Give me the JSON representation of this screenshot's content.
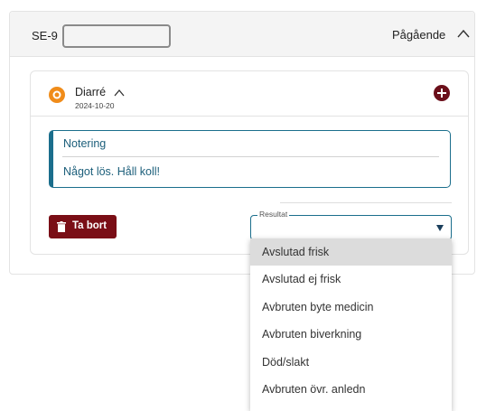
{
  "case": {
    "id_prefix": "SE-9",
    "status": "Pågående"
  },
  "diagnosis": {
    "title": "Diarré",
    "date": "2024-10-20"
  },
  "note": {
    "title": "Notering",
    "text": "Något lös. Håll koll!"
  },
  "actions": {
    "delete_label": "Ta bort"
  },
  "result": {
    "legend": "Resultat",
    "value": "",
    "options": [
      {
        "label": "Avslutad frisk",
        "highlighted": true
      },
      {
        "label": "Avslutad ej frisk",
        "highlighted": false
      },
      {
        "label": "Avbruten byte medicin",
        "highlighted": false
      },
      {
        "label": "Avbruten biverkning",
        "highlighted": false
      },
      {
        "label": "Död/slakt",
        "highlighted": false
      },
      {
        "label": "Avbruten övr. anledn",
        "highlighted": false
      }
    ]
  },
  "icons": {
    "eye": "eye-icon",
    "add": "plus-circle-icon",
    "trash": "trash-icon",
    "chevron_up": "chevron-up-icon",
    "dropdown_arrow": "triangle-down-icon"
  },
  "colors": {
    "brand_dark_red": "#7a0e16",
    "accent_teal": "#1b6e8c",
    "eye_orange": "#f08c1a"
  }
}
